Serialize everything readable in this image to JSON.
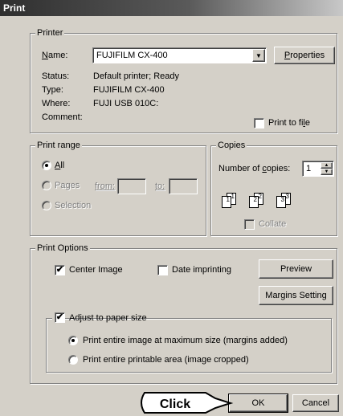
{
  "window": {
    "title": "Print"
  },
  "printer": {
    "legend": "Printer",
    "name_label": "Name:",
    "name_value": "FUJIFILM CX-400",
    "properties_button": "Properties",
    "status_label": "Status:",
    "status_value": "Default printer; Ready",
    "type_label": "Type:",
    "type_value": "FUJIFILM CX-400",
    "where_label": "Where:",
    "where_value": "FUJI USB 010C:",
    "comment_label": "Comment:",
    "print_to_file_label": "Print to file",
    "print_to_file_checked": false
  },
  "print_range": {
    "legend": "Print range",
    "all_label": "All",
    "pages_label": "Pages",
    "from_label": "from:",
    "to_label": "to:",
    "selection_label": "Selection",
    "selected": "All"
  },
  "copies": {
    "legend": "Copies",
    "number_label": "Number of copies:",
    "number_value": "1",
    "collate_label": "Collate",
    "collate_checked": false,
    "collate_icons": [
      "1",
      "1",
      "2",
      "2",
      "3",
      "3"
    ]
  },
  "print_options": {
    "legend": "Print Options",
    "center_image_label": "Center Image",
    "center_image_checked": true,
    "date_imprinting_label": "Date imprinting",
    "date_imprinting_checked": false,
    "preview_button": "Preview",
    "margins_button": "Margins Setting",
    "adjust_label": "Adjust to paper size",
    "adjust_checked": true,
    "option_max_size": "Print entire image at maximum size (margins added)",
    "option_printable_area": "Print entire printable area (image cropped)",
    "selected_option": "max_size"
  },
  "footer": {
    "ok_button": "OK",
    "cancel_button": "Cancel",
    "callout_label": "Click"
  }
}
